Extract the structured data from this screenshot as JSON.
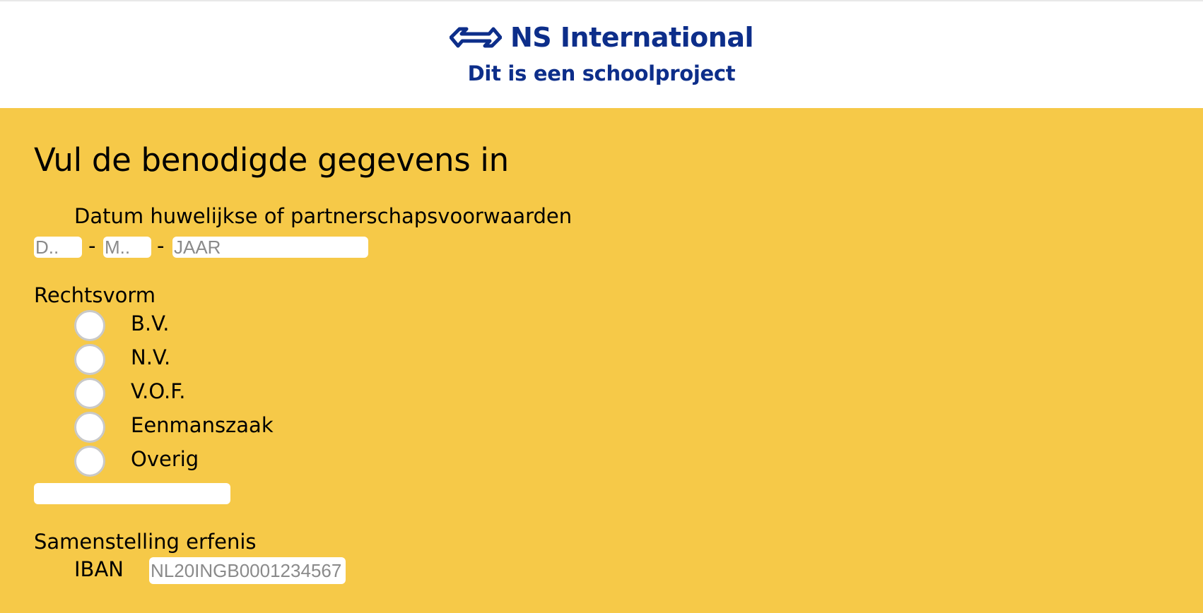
{
  "header": {
    "brand": "NS International",
    "subtitle": "Dit is een schoolproject",
    "brand_color": "#0d2e8a",
    "logo_icon": "ns-arrows-logo-icon"
  },
  "form": {
    "title": "Vul de benodigde gegevens in",
    "date": {
      "label": "Datum huwelijkse of partnerschapsvoorwaarden",
      "day_placeholder": "D..",
      "month_placeholder": "M..",
      "year_placeholder": "JAAR",
      "separator": "-"
    },
    "legal_form": {
      "label": "Rechtsvorm",
      "options": [
        "B.V.",
        "N.V.",
        "V.O.F.",
        "Eenmanszaak",
        "Overig"
      ],
      "other_value": ""
    },
    "inheritance": {
      "label": "Samenstelling erfenis",
      "iban_label": "IBAN",
      "iban_placeholder": "NL20INGB0001234567"
    }
  },
  "colors": {
    "background": "#f6c948",
    "header_background": "#ffffff"
  }
}
